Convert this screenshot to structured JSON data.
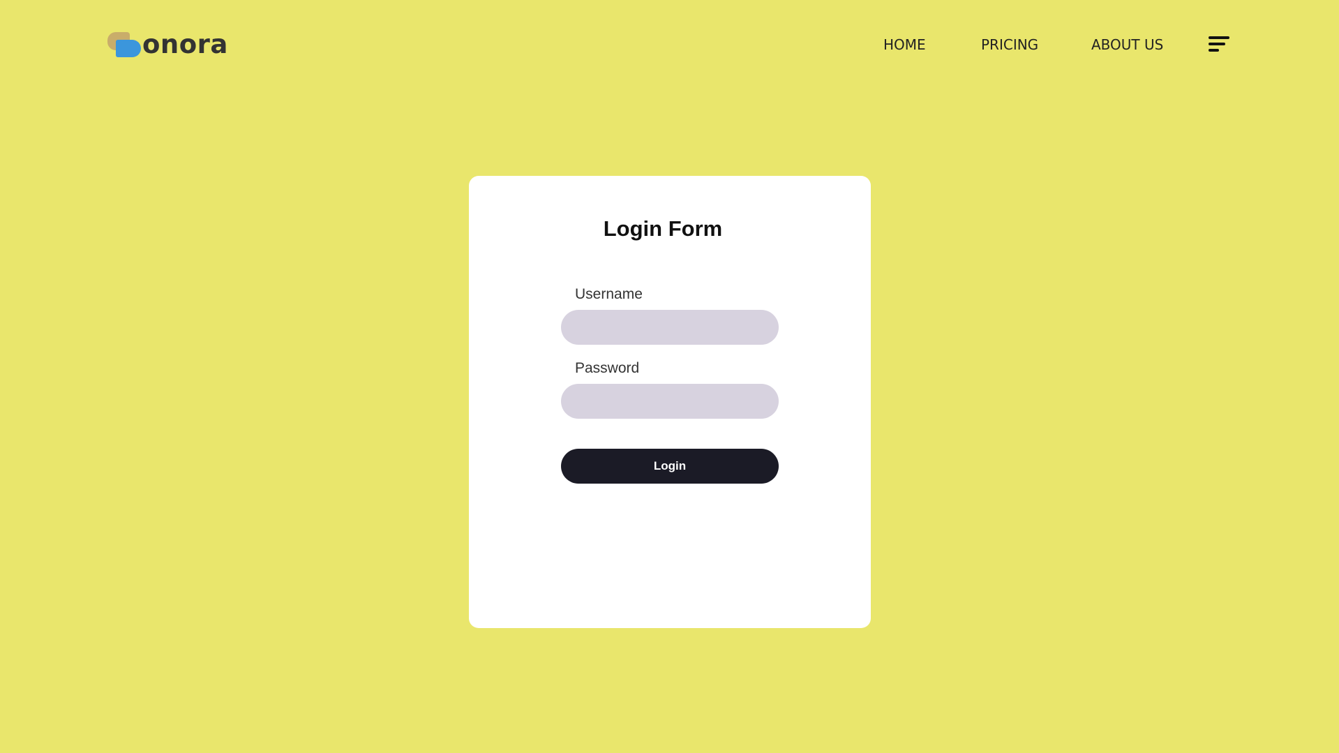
{
  "brand": {
    "name": "onora",
    "logo_colors": {
      "back": "#c9ad6a",
      "front": "#3b96dc"
    }
  },
  "nav": {
    "items": [
      {
        "label": "HOME"
      },
      {
        "label": "PRICING"
      },
      {
        "label": "ABOUT US"
      }
    ],
    "menu_icon": "hamburger-menu-icon"
  },
  "form": {
    "title": "Login Form",
    "username_label": "Username",
    "username_value": "",
    "password_label": "Password",
    "password_value": "",
    "login_label": "Login"
  },
  "colors": {
    "background": "#e9e66c",
    "card": "#ffffff",
    "input": "#d7d2df",
    "button": "#1b1b26"
  }
}
